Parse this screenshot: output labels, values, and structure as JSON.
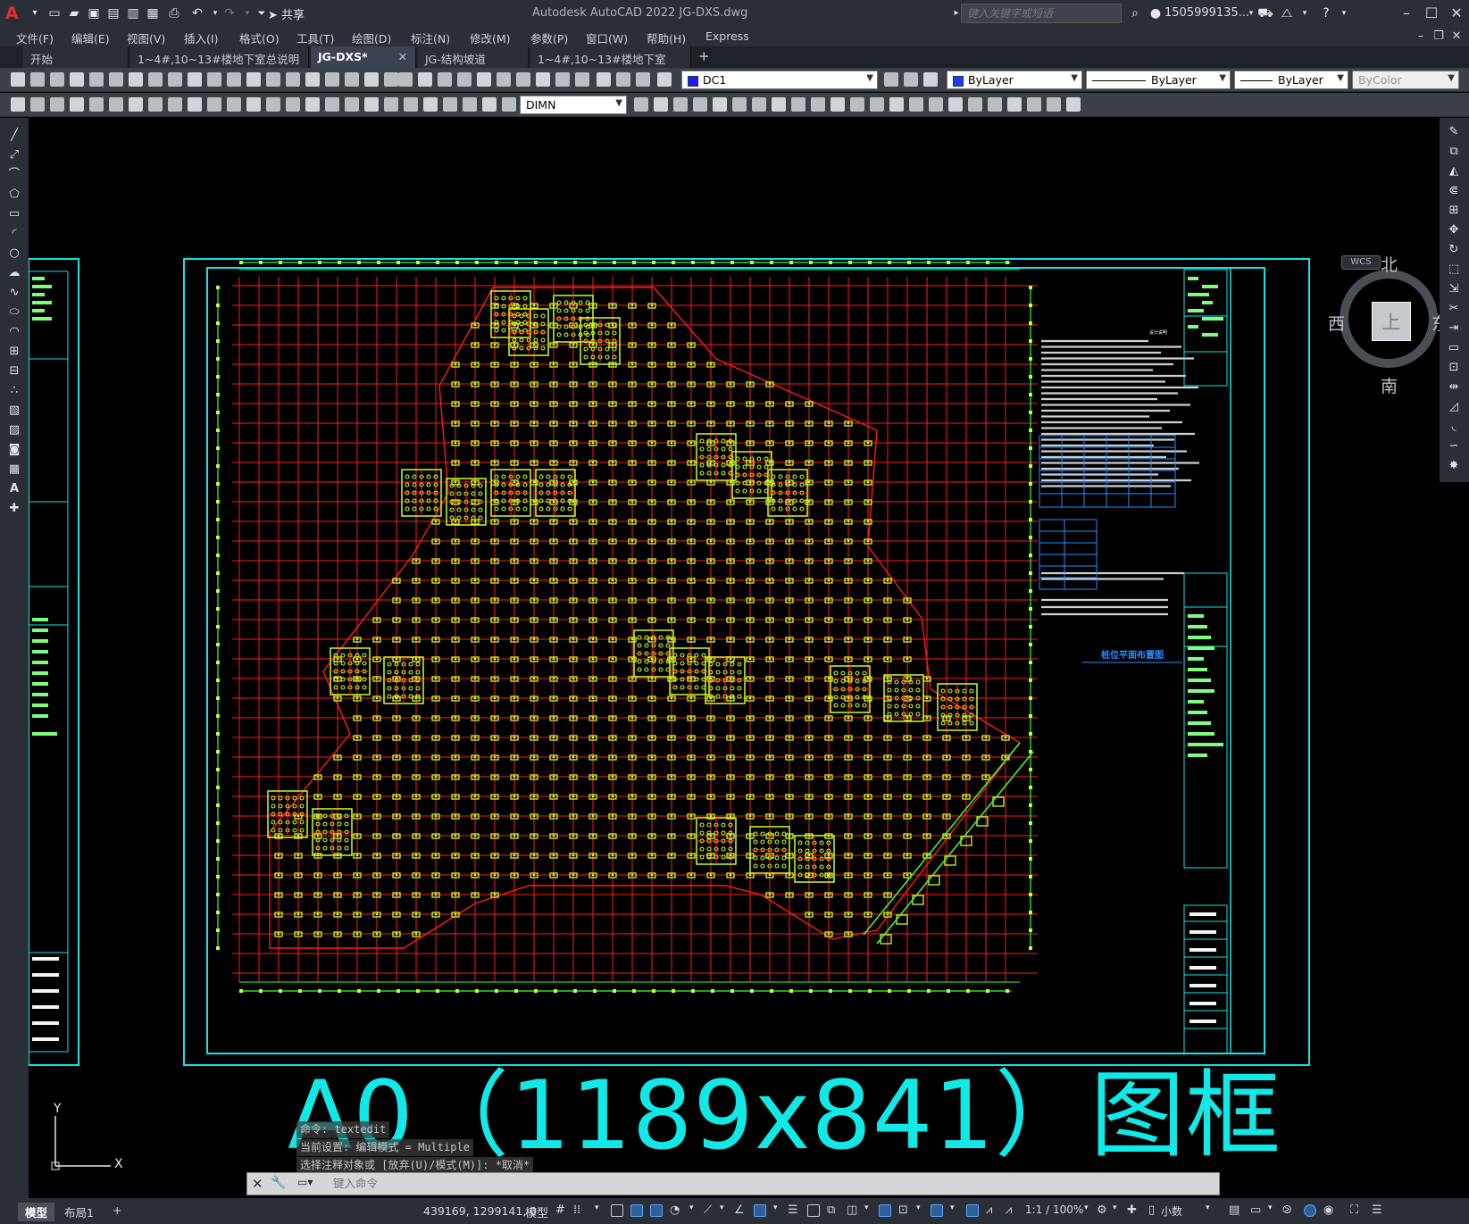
{
  "app": {
    "logo": "A",
    "title": "Autodesk AutoCAD 2022    JG-DXS.dwg",
    "share_label": "共享",
    "search_placeholder": "键入关键字或短语",
    "user": "1505999135...",
    "qa_icons": [
      "new-icon",
      "open-icon",
      "save-icon",
      "saveas-icon",
      "publish-icon",
      "plot-icon",
      "print-icon",
      "undo-icon",
      "redo-icon"
    ]
  },
  "menu": [
    "文件(F)",
    "编辑(E)",
    "视图(V)",
    "插入(I)",
    "格式(O)",
    "工具(T)",
    "绘图(D)",
    "标注(N)",
    "修改(M)",
    "参数(P)",
    "窗口(W)",
    "帮助(H)",
    "Express"
  ],
  "file_tabs": [
    {
      "label": "开始",
      "active": false,
      "closable": false
    },
    {
      "label": "1~4#,10~13#楼地下室总说明",
      "active": false,
      "closable": true
    },
    {
      "label": "JG-DXS*",
      "active": true,
      "closable": true
    },
    {
      "label": "JG-结构坡道*",
      "active": false,
      "closable": true
    },
    {
      "label": "1~4#,10~13#楼地下室*",
      "active": false,
      "closable": true
    }
  ],
  "properties": {
    "layer": "DC1",
    "layer_color": "#1a1aff",
    "color": "ByLayer",
    "color_swatch": "#1a3cff",
    "linetype": "ByLayer",
    "lineweight": "ByLayer",
    "plotstyle": "ByColor",
    "dimstyle": "DIMN"
  },
  "viewcube": {
    "north": "北",
    "south": "南",
    "east": "东",
    "west": "西",
    "face": "上",
    "wcs": "WCS"
  },
  "drawing": {
    "frame_title": "A0（1189x841）图框",
    "plan_title": "桩位平面布置图",
    "notes_title": "设计说明",
    "colors": {
      "frame": "#10e6e6",
      "grid": "#ff1a1a",
      "piles": "#c8ff2a",
      "outline": "#3dff3d"
    }
  },
  "ucs": {
    "y": "Y",
    "x": "X"
  },
  "command": {
    "history": [
      "命令:  textedit",
      "当前设置: 编辑模式 = Multiple",
      "选择注释对象或 [放弃(U)/模式(M)]: *取消*"
    ],
    "placeholder": "键入命令"
  },
  "layout_tabs": [
    {
      "label": "模型",
      "active": true
    },
    {
      "label": "布局1",
      "active": false
    },
    {
      "label": "+",
      "active": false
    }
  ],
  "status": {
    "coords": "439169, 1299141, 0",
    "space": "模型",
    "scale": "1:1 / 100%",
    "units": "小数"
  }
}
